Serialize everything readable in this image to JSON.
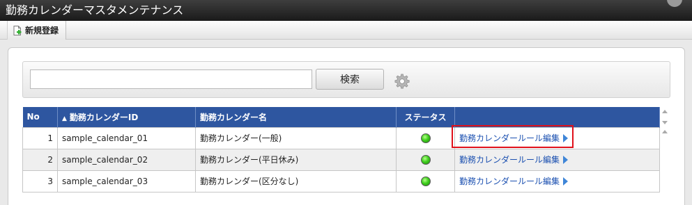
{
  "window": {
    "title": "勤務カレンダーマスタメンテナンス"
  },
  "toolbar": {
    "new_label": "新規登録"
  },
  "search": {
    "value": "",
    "placeholder": "",
    "button_label": "検索"
  },
  "table": {
    "columns": {
      "no": "No",
      "id": "勤務カレンダーID",
      "name": "勤務カレンダー名",
      "status": "ステータス",
      "action": ""
    },
    "rows": [
      {
        "no": "1",
        "id": "sample_calendar_01",
        "name": "勤務カレンダー(一般)",
        "status": "active",
        "link": "勤務カレンダールール編集"
      },
      {
        "no": "2",
        "id": "sample_calendar_02",
        "name": "勤務カレンダー(平日休み)",
        "status": "active",
        "link": "勤務カレンダールール編集"
      },
      {
        "no": "3",
        "id": "sample_calendar_03",
        "name": "勤務カレンダー(区分なし)",
        "status": "active",
        "link": "勤務カレンダールール編集"
      }
    ]
  },
  "colors": {
    "header_bg": "#2e56a0",
    "link": "#1a4fb0",
    "status_active": "#3fcf1e",
    "highlight": "#e0101a"
  },
  "icons": {
    "new": "new-document-icon",
    "settings": "gear-icon",
    "sort": "sort-ascending-icon",
    "row_action": "play-arrow-icon"
  }
}
